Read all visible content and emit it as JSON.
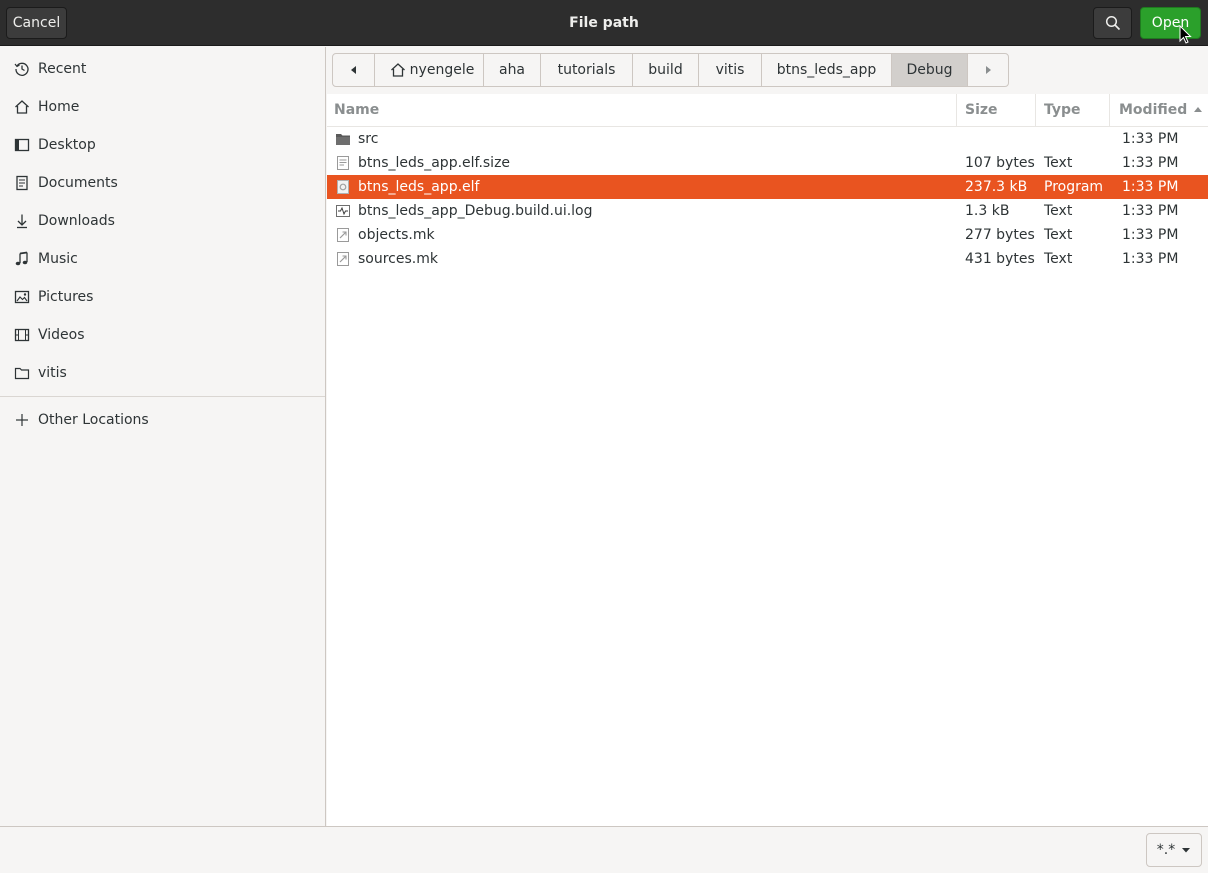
{
  "header": {
    "title": "File path",
    "cancel_label": "Cancel",
    "open_label": "Open"
  },
  "sidebar": {
    "items": [
      {
        "label": "Recent",
        "icon": "clock-icon"
      },
      {
        "label": "Home",
        "icon": "home-icon"
      },
      {
        "label": "Desktop",
        "icon": "desktop-icon"
      },
      {
        "label": "Documents",
        "icon": "document-icon"
      },
      {
        "label": "Downloads",
        "icon": "download-icon"
      },
      {
        "label": "Music",
        "icon": "music-icon"
      },
      {
        "label": "Pictures",
        "icon": "picture-icon"
      },
      {
        "label": "Videos",
        "icon": "video-icon"
      },
      {
        "label": "vitis",
        "icon": "folder-icon"
      }
    ],
    "other_locations": "Other Locations"
  },
  "pathbar": {
    "crumbs": [
      "nyengele",
      "aha",
      "tutorials",
      "build",
      "vitis",
      "btns_leds_app",
      "Debug"
    ],
    "active": "Debug"
  },
  "filelist": {
    "columns": {
      "name": "Name",
      "size": "Size",
      "type": "Type",
      "modified": "Modified"
    },
    "sort_column": "Modified",
    "rows": [
      {
        "name": "src",
        "size": "",
        "type": "",
        "modified": "1:33 PM",
        "icon": "folder-icon"
      },
      {
        "name": "btns_leds_app.elf.size",
        "size": "107 bytes",
        "type": "Text",
        "modified": "1:33 PM",
        "icon": "text-file-icon"
      },
      {
        "name": "btns_leds_app.elf",
        "size": "237.3 kB",
        "type": "Program",
        "modified": "1:33 PM",
        "icon": "executable-icon",
        "selected": true
      },
      {
        "name": "btns_leds_app_Debug.build.ui.log",
        "size": "1.3 kB",
        "type": "Text",
        "modified": "1:33 PM",
        "icon": "log-file-icon"
      },
      {
        "name": "objects.mk",
        "size": "277 bytes",
        "type": "Text",
        "modified": "1:33 PM",
        "icon": "makefile-icon"
      },
      {
        "name": "sources.mk",
        "size": "431 bytes",
        "type": "Text",
        "modified": "1:33 PM",
        "icon": "makefile-icon"
      }
    ]
  },
  "footer": {
    "filter_label": "*.*"
  },
  "colors": {
    "accent": "#e95420",
    "open_button": "#2ba02b",
    "header_bg": "#2d2d2d"
  }
}
